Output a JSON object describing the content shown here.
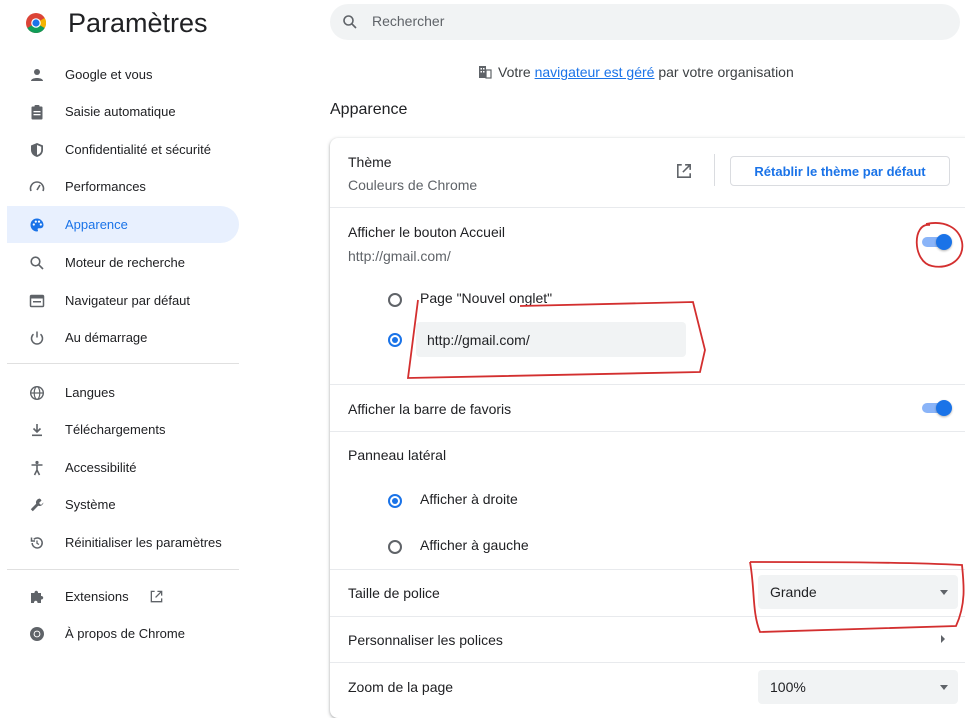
{
  "header": {
    "title": "Paramètres",
    "search_placeholder": "Rechercher"
  },
  "sidebar": {
    "items": [
      {
        "label": "Google et vous",
        "icon": "person-icon"
      },
      {
        "label": "Saisie automatique",
        "icon": "clipboard-icon"
      },
      {
        "label": "Confidentialité et sécurité",
        "icon": "shield-icon"
      },
      {
        "label": "Performances",
        "icon": "speedometer-icon"
      },
      {
        "label": "Apparence",
        "icon": "palette-icon",
        "active": true
      },
      {
        "label": "Moteur de recherche",
        "icon": "search-icon"
      },
      {
        "label": "Navigateur par défaut",
        "icon": "browser-window-icon"
      },
      {
        "label": "Au démarrage",
        "icon": "power-icon"
      },
      {
        "label": "Langues",
        "icon": "globe-icon"
      },
      {
        "label": "Téléchargements",
        "icon": "download-icon"
      },
      {
        "label": "Accessibilité",
        "icon": "accessibility-icon"
      },
      {
        "label": "Système",
        "icon": "wrench-icon"
      },
      {
        "label": "Réinitialiser les paramètres",
        "icon": "restore-icon"
      },
      {
        "label": "Extensions",
        "icon": "puzzle-icon"
      },
      {
        "label": "À propos de Chrome",
        "icon": "chrome-logo-icon"
      }
    ]
  },
  "managed_notice": {
    "prefix": "Votre ",
    "link": "navigateur est géré",
    "suffix": " par votre organisation"
  },
  "section": {
    "title": "Apparence",
    "theme": {
      "label": "Thème",
      "value": "Couleurs de Chrome",
      "reset_button": "Rétablir le thème par défaut"
    },
    "home_button": {
      "label": "Afficher le bouton Accueil",
      "url": "http://gmail.com/",
      "enabled": true,
      "options": [
        {
          "label": "Page \"Nouvel onglet\"",
          "selected": false
        },
        {
          "label": "",
          "selected": true
        }
      ],
      "custom_url_value": "http://gmail.com/"
    },
    "bookmarks_bar": {
      "label": "Afficher la barre de favoris",
      "enabled": true
    },
    "side_panel": {
      "label": "Panneau latéral",
      "options": [
        {
          "label": "Afficher à droite",
          "selected": true
        },
        {
          "label": "Afficher à gauche",
          "selected": false
        }
      ]
    },
    "font_size": {
      "label": "Taille de police",
      "value": "Grande"
    },
    "customize_fonts": {
      "label": "Personnaliser les polices"
    },
    "page_zoom": {
      "label": "Zoom de la page",
      "value": "100%"
    }
  },
  "colors": {
    "accent": "#1a73e8",
    "active_bg": "#e8f0fe",
    "annotation": "#d32f2f"
  }
}
